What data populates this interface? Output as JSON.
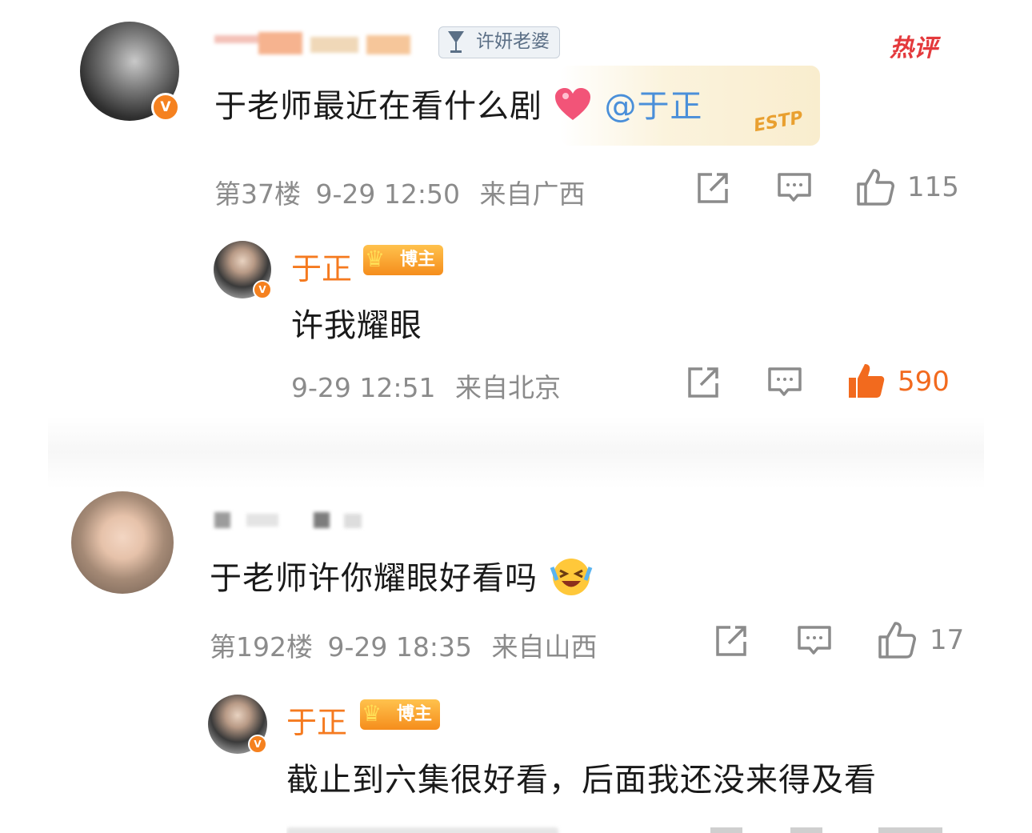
{
  "comments": [
    {
      "badge_label": "许妍老婆",
      "hot_tag": "热评",
      "text": "于老师最近在看什么剧",
      "mention": "@于正",
      "card_text": "ESTP",
      "floor": "第37楼",
      "time": "9-29 12:50",
      "location": "来自广西",
      "likes": "115",
      "reply": {
        "name": "于正",
        "badge": "博主",
        "text": "许我耀眼",
        "time": "9-29 12:51",
        "location": "来自北京",
        "likes": "590"
      }
    },
    {
      "text": "于老师许你耀眼好看吗",
      "floor": "第192楼",
      "time": "9-29 18:35",
      "location": "来自山西",
      "likes": "17",
      "reply": {
        "name": "于正",
        "badge": "博主",
        "text": "截止到六集很好看，后面我还没来得及看"
      }
    }
  ],
  "colors": {
    "accent_orange": "#f57a1f",
    "mention_blue": "#4a8fd9",
    "meta_gray": "#8b8b8b",
    "hot_red": "#e4393c"
  }
}
